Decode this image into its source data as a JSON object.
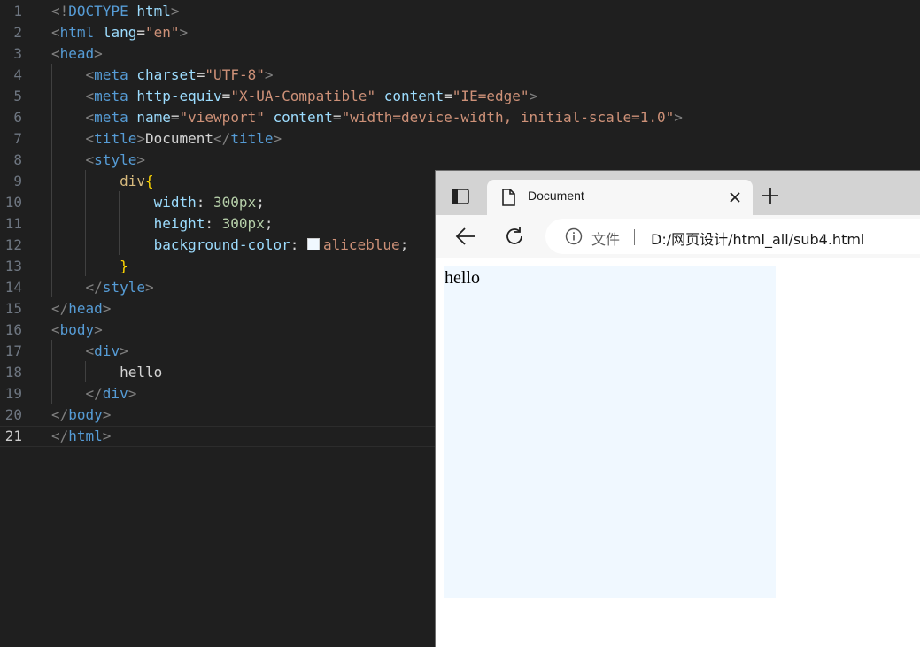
{
  "editor": {
    "lines": [
      {
        "n": "1",
        "tokens": [
          {
            "t": "punc",
            "v": "<!"
          },
          {
            "t": "tag",
            "v": "DOCTYPE"
          },
          {
            "t": "text",
            "v": " "
          },
          {
            "t": "attr",
            "v": "html"
          },
          {
            "t": "punc",
            "v": ">"
          }
        ]
      },
      {
        "n": "2",
        "tokens": [
          {
            "t": "punc",
            "v": "<"
          },
          {
            "t": "tag",
            "v": "html"
          },
          {
            "t": "text",
            "v": " "
          },
          {
            "t": "attr",
            "v": "lang"
          },
          {
            "t": "text",
            "v": "="
          },
          {
            "t": "str",
            "v": "\"en\""
          },
          {
            "t": "punc",
            "v": ">"
          }
        ]
      },
      {
        "n": "3",
        "tokens": [
          {
            "t": "punc",
            "v": "<"
          },
          {
            "t": "tag",
            "v": "head"
          },
          {
            "t": "punc",
            "v": ">"
          }
        ]
      },
      {
        "n": "4",
        "tokens": [
          {
            "t": "text",
            "v": "    "
          },
          {
            "t": "punc",
            "v": "<"
          },
          {
            "t": "tag",
            "v": "meta"
          },
          {
            "t": "text",
            "v": " "
          },
          {
            "t": "attr",
            "v": "charset"
          },
          {
            "t": "text",
            "v": "="
          },
          {
            "t": "str",
            "v": "\"UTF-8\""
          },
          {
            "t": "punc",
            "v": ">"
          }
        ]
      },
      {
        "n": "5",
        "tokens": [
          {
            "t": "text",
            "v": "    "
          },
          {
            "t": "punc",
            "v": "<"
          },
          {
            "t": "tag",
            "v": "meta"
          },
          {
            "t": "text",
            "v": " "
          },
          {
            "t": "attr",
            "v": "http-equiv"
          },
          {
            "t": "text",
            "v": "="
          },
          {
            "t": "str",
            "v": "\"X-UA-Compatible\""
          },
          {
            "t": "text",
            "v": " "
          },
          {
            "t": "attr",
            "v": "content"
          },
          {
            "t": "text",
            "v": "="
          },
          {
            "t": "str",
            "v": "\"IE=edge\""
          },
          {
            "t": "punc",
            "v": ">"
          }
        ]
      },
      {
        "n": "6",
        "tokens": [
          {
            "t": "text",
            "v": "    "
          },
          {
            "t": "punc",
            "v": "<"
          },
          {
            "t": "tag",
            "v": "meta"
          },
          {
            "t": "text",
            "v": " "
          },
          {
            "t": "attr",
            "v": "name"
          },
          {
            "t": "text",
            "v": "="
          },
          {
            "t": "str",
            "v": "\"viewport\""
          },
          {
            "t": "text",
            "v": " "
          },
          {
            "t": "attr",
            "v": "content"
          },
          {
            "t": "text",
            "v": "="
          },
          {
            "t": "str",
            "v": "\"width=device-width, initial-scale=1.0\""
          },
          {
            "t": "punc",
            "v": ">"
          }
        ]
      },
      {
        "n": "7",
        "tokens": [
          {
            "t": "text",
            "v": "    "
          },
          {
            "t": "punc",
            "v": "<"
          },
          {
            "t": "tag",
            "v": "title"
          },
          {
            "t": "punc",
            "v": ">"
          },
          {
            "t": "text",
            "v": "Document"
          },
          {
            "t": "punc",
            "v": "</"
          },
          {
            "t": "tag",
            "v": "title"
          },
          {
            "t": "punc",
            "v": ">"
          }
        ]
      },
      {
        "n": "8",
        "tokens": [
          {
            "t": "text",
            "v": "    "
          },
          {
            "t": "punc",
            "v": "<"
          },
          {
            "t": "tag",
            "v": "style"
          },
          {
            "t": "punc",
            "v": ">"
          }
        ]
      },
      {
        "n": "9",
        "tokens": [
          {
            "t": "text",
            "v": "        "
          },
          {
            "t": "sel",
            "v": "div"
          },
          {
            "t": "brace",
            "v": "{"
          }
        ]
      },
      {
        "n": "10",
        "tokens": [
          {
            "t": "text",
            "v": "            "
          },
          {
            "t": "prop",
            "v": "width"
          },
          {
            "t": "text",
            "v": ": "
          },
          {
            "t": "num",
            "v": "300px"
          },
          {
            "t": "text",
            "v": ";"
          }
        ]
      },
      {
        "n": "11",
        "tokens": [
          {
            "t": "text",
            "v": "            "
          },
          {
            "t": "prop",
            "v": "height"
          },
          {
            "t": "text",
            "v": ": "
          },
          {
            "t": "num",
            "v": "300px"
          },
          {
            "t": "text",
            "v": ";"
          }
        ]
      },
      {
        "n": "12",
        "tokens": [
          {
            "t": "text",
            "v": "            "
          },
          {
            "t": "prop",
            "v": "background-color"
          },
          {
            "t": "text",
            "v": ": "
          },
          {
            "t": "swatch",
            "v": ""
          },
          {
            "t": "val",
            "v": "aliceblue"
          },
          {
            "t": "text",
            "v": ";"
          }
        ]
      },
      {
        "n": "13",
        "tokens": [
          {
            "t": "text",
            "v": "        "
          },
          {
            "t": "brace",
            "v": "}"
          }
        ]
      },
      {
        "n": "14",
        "tokens": [
          {
            "t": "text",
            "v": "    "
          },
          {
            "t": "punc",
            "v": "</"
          },
          {
            "t": "tag",
            "v": "style"
          },
          {
            "t": "punc",
            "v": ">"
          }
        ]
      },
      {
        "n": "15",
        "tokens": [
          {
            "t": "punc",
            "v": "</"
          },
          {
            "t": "tag",
            "v": "head"
          },
          {
            "t": "punc",
            "v": ">"
          }
        ]
      },
      {
        "n": "16",
        "tokens": [
          {
            "t": "punc",
            "v": "<"
          },
          {
            "t": "tag",
            "v": "body"
          },
          {
            "t": "punc",
            "v": ">"
          }
        ]
      },
      {
        "n": "17",
        "tokens": [
          {
            "t": "text",
            "v": "    "
          },
          {
            "t": "punc",
            "v": "<"
          },
          {
            "t": "tag",
            "v": "div"
          },
          {
            "t": "punc",
            "v": ">"
          }
        ]
      },
      {
        "n": "18",
        "tokens": [
          {
            "t": "text",
            "v": "        hello"
          }
        ]
      },
      {
        "n": "19",
        "tokens": [
          {
            "t": "text",
            "v": "    "
          },
          {
            "t": "punc",
            "v": "</"
          },
          {
            "t": "tag",
            "v": "div"
          },
          {
            "t": "punc",
            "v": ">"
          }
        ]
      },
      {
        "n": "20",
        "tokens": [
          {
            "t": "punc",
            "v": "</"
          },
          {
            "t": "tag",
            "v": "body"
          },
          {
            "t": "punc",
            "v": ">"
          }
        ]
      },
      {
        "n": "21",
        "tokens": [
          {
            "t": "punc",
            "v": "</"
          },
          {
            "t": "tag",
            "v": "html"
          },
          {
            "t": "punc",
            "v": ">"
          }
        ]
      }
    ],
    "active_line": "21"
  },
  "browser": {
    "tab_title": "Document",
    "file_label": "文件",
    "url": "D:/网页设计/html_all/sub4.html",
    "page_text": "hello",
    "div_color": "#f0f8ff"
  },
  "icons": {
    "tab_actions": "tab-actions-icon",
    "page": "page-icon",
    "close": "close-icon",
    "new_tab": "plus-icon",
    "back": "back-arrow-icon",
    "refresh": "refresh-icon",
    "info": "info-icon"
  }
}
